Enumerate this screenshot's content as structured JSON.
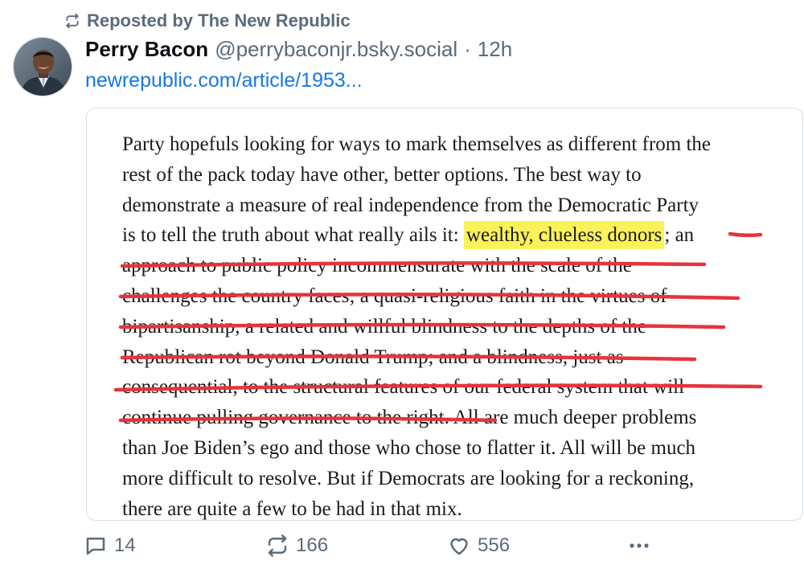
{
  "repost": {
    "label": "Reposted by The New Republic"
  },
  "author": {
    "name": "Perry Bacon",
    "handle": "@perrybaconjr.bsky.social",
    "separator": "·",
    "time": "12h"
  },
  "post": {
    "link_text": "newrepublic.com/article/1953..."
  },
  "quote": {
    "line1": "Party hopefuls looking for ways to mark themselves as different from the",
    "line2": "rest of the pack today have other, better options. The best way to",
    "line3": "demonstrate a measure of real independence from the Democratic Party",
    "line4_before": "is to tell the truth about what really ails it: ",
    "highlight": "wealthy, clueless donors",
    "line4_after": "; an",
    "line5": "approach to public policy incommensurate with the scale of the",
    "line6": "challenges the country faces; a quasi-religious faith in the virtues of",
    "line7": "bipartisanship, a related and willful blindness to the depths of the",
    "line8": "Republican rot beyond Donald Trump; and a blindness, just as",
    "line9": "consequential, to the structural features of our federal system that will",
    "line10_struck": "continue pulling governance to the right.",
    "line10_after": " All are much deeper problems",
    "line11": "than Joe Biden’s ego and those who chose to flatter it. All will be much",
    "line12": "more difficult to resolve. But if Democrats are looking for a reckoning,",
    "line13": "there are quite a few to be had in that mix.",
    "highlight_color": "#fbf25a",
    "strike_color": "#e8333c"
  },
  "actions": {
    "replies": "14",
    "reposts": "166",
    "likes": "556",
    "more_icon": "ellipsis-icon"
  },
  "colors": {
    "link": "#1677e8",
    "muted": "#5b6b7b"
  }
}
